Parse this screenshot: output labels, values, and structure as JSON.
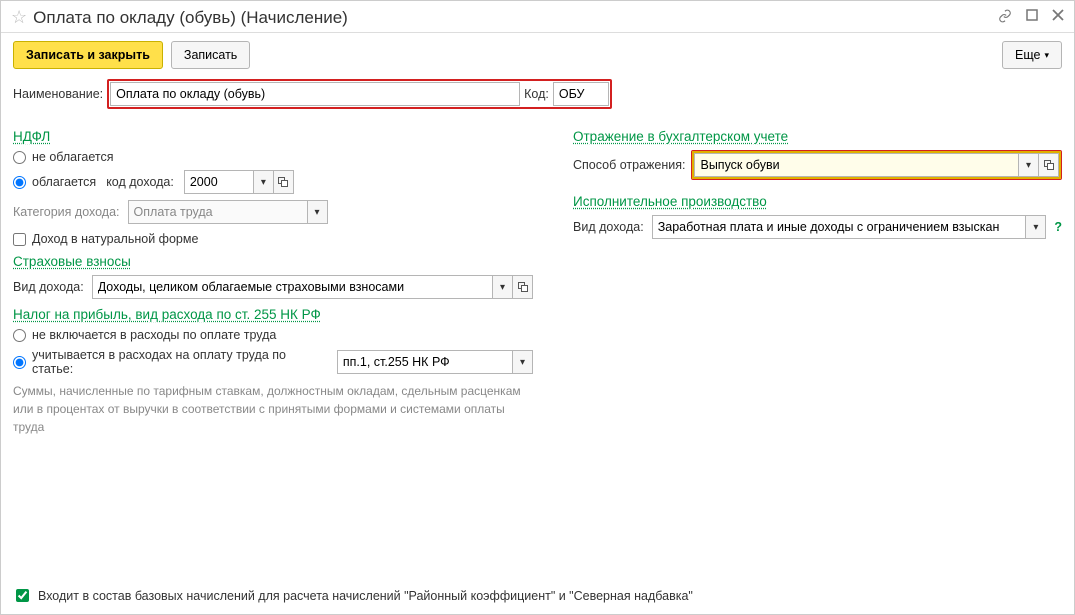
{
  "window": {
    "title": "Оплата по окладу (обувь) (Начисление)"
  },
  "toolbar": {
    "save_close": "Записать и закрыть",
    "save": "Записать",
    "more": "Еще"
  },
  "name_row": {
    "label": "Наименование:",
    "value": "Оплата по окладу (обувь)",
    "code_label": "Код:",
    "code_value": "ОБУ"
  },
  "ndfl": {
    "title": "НДФЛ",
    "opt_none": "не облагается",
    "opt_taxed": "облагается",
    "code_label": "код дохода:",
    "code_value": "2000",
    "category_label": "Категория дохода:",
    "category_value": "Оплата труда",
    "natural_label": "Доход в натуральной форме"
  },
  "insurance": {
    "title": "Страховые взносы",
    "label": "Вид дохода:",
    "value": "Доходы, целиком облагаемые страховыми взносами"
  },
  "profit_tax": {
    "title": "Налог на прибыль, вид расхода по ст. 255 НК РФ",
    "opt_none": "не включается в расходы по оплате труда",
    "opt_inc": "учитывается в расходах на оплату труда по статье:",
    "article_value": "пп.1, ст.255 НК РФ",
    "hint": "Суммы, начисленные по тарифным ставкам, должностным окладам, сдельным расценкам или в процентах от выручки в соответствии с принятыми формами и системами оплаты труда"
  },
  "accounting": {
    "title": "Отражение в бухгалтерском учете",
    "label": "Способ отражения:",
    "value": "Выпуск обуви"
  },
  "enforcement": {
    "title": "Исполнительное производство",
    "label": "Вид дохода:",
    "value": "Заработная плата и иные доходы с ограничением взыскан"
  },
  "footer": {
    "label": "Входит в состав базовых начислений для расчета начислений \"Районный коэффициент\" и \"Северная надбавка\""
  }
}
